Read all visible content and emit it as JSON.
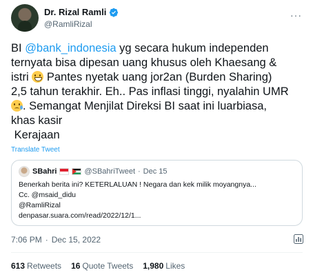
{
  "author": {
    "name": "Dr. Rizal Ramli",
    "handle": "@RamliRizal"
  },
  "tweet": {
    "part1": "BI ",
    "mention": "@bank_indonesia",
    "part2": " yg secara hukum independen\nternyata bisa dipesan uang khusus oleh Khaesang &\nistri ",
    "part3": " Pantes nyetak uang jor2an (Burden Sharing)\n2,5 tahun terakhir. Eh.. Pas inflasi tinggi, nyalahin UMR\n",
    "part4": ". Semangat Menjilat Direksi BI saat ini luarbiasa,\nkhas kasir\n Kerajaan",
    "emoji1": "grinning-face-with-sweat",
    "emoji2": "face-holding-back-tears"
  },
  "translate_label": "Translate Tweet",
  "quote": {
    "name": "SBahri",
    "handle": "@SBahriTweet",
    "separator": "·",
    "date": "Dec 15",
    "text": "Benerkah berita ini? KETERLALUAN ! Negara dan kek milik moyangnya...\nCc. @msaid_didu\n@RamliRizal\ndenpasar.suara.com/read/2022/12/1..."
  },
  "timestamp": {
    "time": "7:06 PM",
    "separator": "·",
    "date": "Dec 15, 2022"
  },
  "stats": {
    "retweets_count": "613",
    "retweets_label": "Retweets",
    "quotes_count": "16",
    "quotes_label": "Quote Tweets",
    "likes_count": "1,980",
    "likes_label": "Likes"
  },
  "colors": {
    "link": "#1d9bf0",
    "text": "#0f1419",
    "muted": "#536471",
    "border": "#cfd9de"
  }
}
